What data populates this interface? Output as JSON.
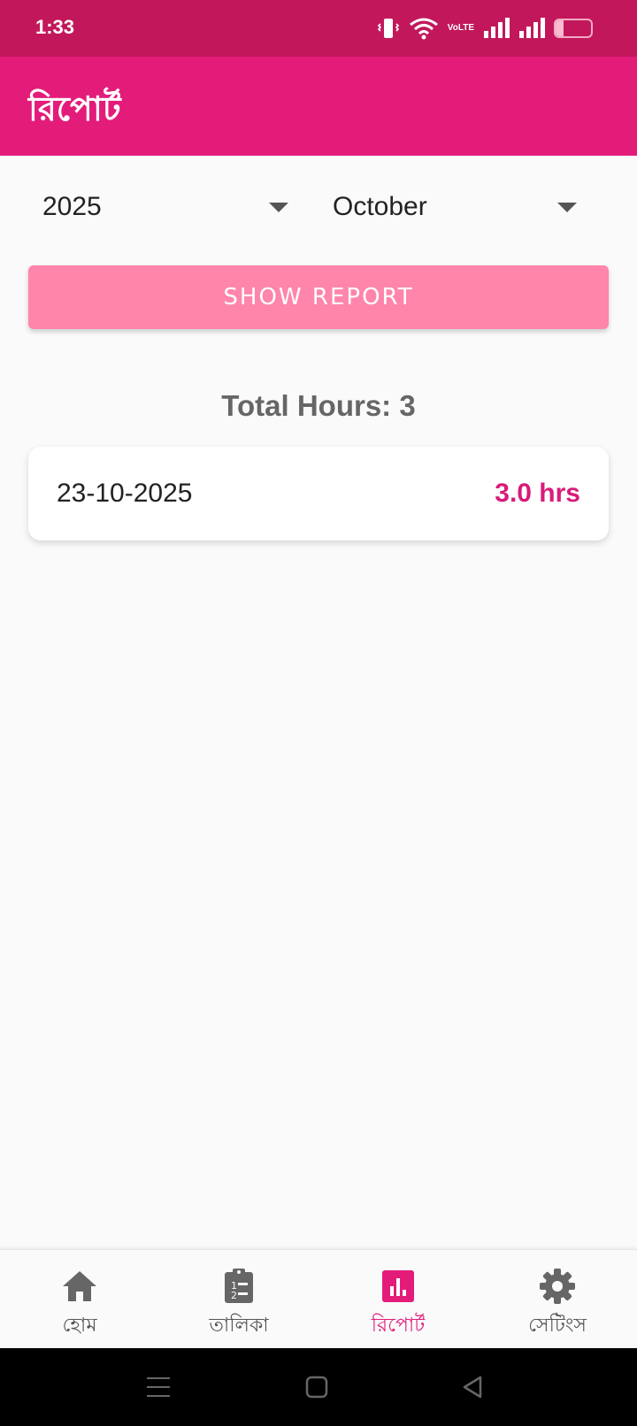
{
  "status_bar": {
    "time": "1:33",
    "network_label_top": "Vo",
    "network_label_bottom": "LTE",
    "battery_percent": 22,
    "battery_text": "22"
  },
  "app_bar": {
    "title": "রিপোর্ট"
  },
  "filters": {
    "year": "2025",
    "month": "October"
  },
  "show_button": {
    "label": "SHOW REPORT"
  },
  "summary": {
    "total_text": "Total Hours: 3"
  },
  "rows": [
    {
      "date": "23-10-2025",
      "hours": "3.0 hrs"
    }
  ],
  "bottom_nav": {
    "items": [
      {
        "label": "হোম",
        "icon": "home-icon",
        "active": false
      },
      {
        "label": "তালিকা",
        "icon": "list-clipboard-icon",
        "active": false
      },
      {
        "label": "রিপোর্ট",
        "icon": "bar-chart-icon",
        "active": true
      },
      {
        "label": "সেটিংস",
        "icon": "gear-icon",
        "active": false
      }
    ]
  },
  "colors": {
    "status_bar": "#c2185b",
    "app_bar": "#e31c7a",
    "button": "#ff85aa",
    "accent": "#d81b7a"
  }
}
